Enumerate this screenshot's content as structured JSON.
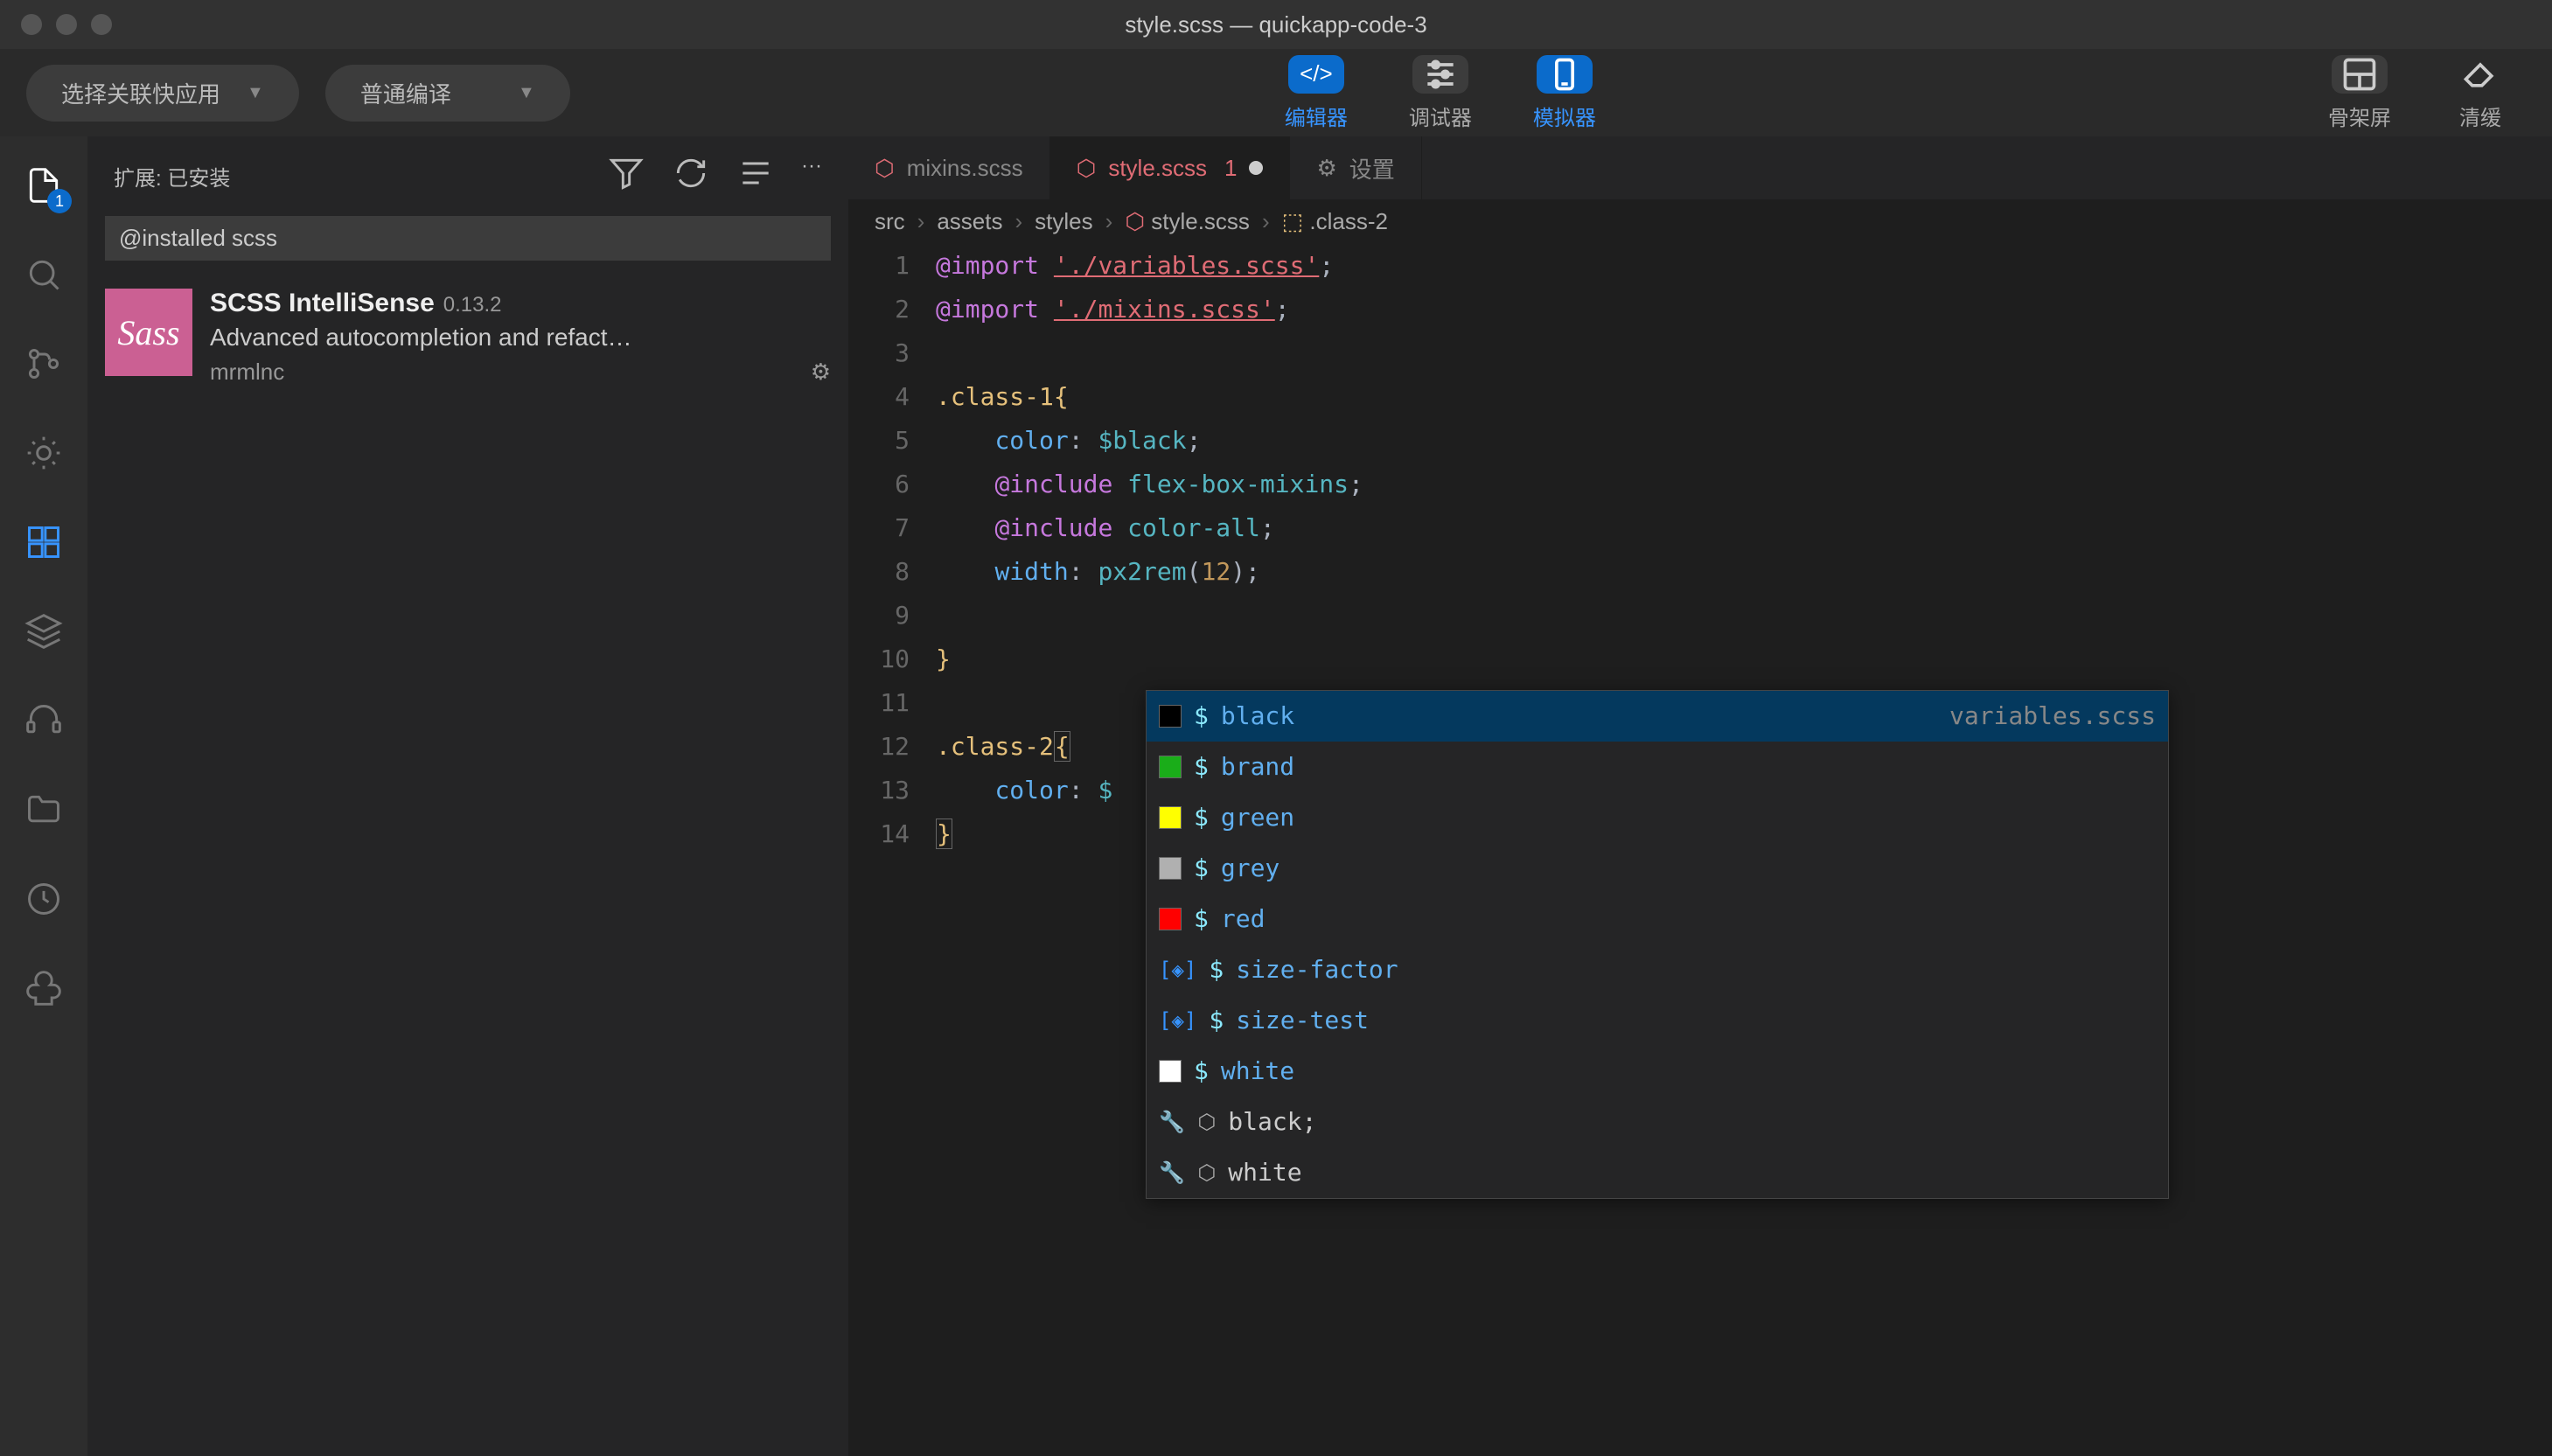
{
  "window": {
    "title": "style.scss — quickapp-code-3"
  },
  "toolbar": {
    "dropdown1": "选择关联快应用",
    "dropdown2": "普通编译",
    "buttons": {
      "editor": "编辑器",
      "debugger": "调试器",
      "simulator": "模拟器",
      "skeleton": "骨架屏",
      "clear": "清缓"
    }
  },
  "sidebar": {
    "header": "扩展: 已安装",
    "search": "@installed scss",
    "ext": {
      "name": "SCSS IntelliSense",
      "version": "0.13.2",
      "desc": "Advanced autocompletion and refact…",
      "author": "mrmlnc",
      "logo": "Sass"
    }
  },
  "tabs": [
    {
      "icon": "sass",
      "label": "mixins.scss",
      "active": false
    },
    {
      "icon": "sass",
      "label": "style.scss",
      "indicator": "1",
      "dirty": true,
      "active": true
    },
    {
      "icon": "settings",
      "label": "设置",
      "active": false
    }
  ],
  "breadcrumbs": [
    "src",
    "assets",
    "styles",
    "style.scss",
    ".class-2"
  ],
  "code": {
    "lines": [
      {
        "n": 1,
        "html": "<span class='kw'>@import</span> <span class='str'>'./variables.scss'</span><span class='punc'>;</span>"
      },
      {
        "n": 2,
        "html": "<span class='kw'>@import</span> <span class='str'>'./mixins.scss'</span><span class='punc'>;</span>"
      },
      {
        "n": 3,
        "html": ""
      },
      {
        "n": 4,
        "html": "<span class='sel'>.class-1</span><span class='brace'>{</span>"
      },
      {
        "n": 5,
        "html": "    <span class='prop'>color</span><span class='punc'>:</span> <span class='var'>$black</span><span class='punc'>;</span>"
      },
      {
        "n": 6,
        "html": "    <span class='inc'>@include</span> <span class='mix'>flex-box-mixins</span><span class='punc'>;</span>"
      },
      {
        "n": 7,
        "html": "    <span class='inc'>@include</span> <span class='mix'>color-all</span><span class='punc'>;</span>"
      },
      {
        "n": 8,
        "html": "    <span class='prop'>width</span><span class='punc'>:</span> <span class='fn'>px2rem</span><span class='punc'>(</span><span class='num'>12</span><span class='punc'>);</span>"
      },
      {
        "n": 9,
        "html": ""
      },
      {
        "n": 10,
        "html": "<span class='brace'>}</span>"
      },
      {
        "n": 11,
        "html": ""
      },
      {
        "n": 12,
        "html": "<span class='sel'>.class-2</span><span class='brace br-hl'>{</span>"
      },
      {
        "n": 13,
        "html": "    <span class='prop'>color</span><span class='punc'>:</span> <span class='var'>$</span>"
      },
      {
        "n": 14,
        "html": "<span class='brace br-hl'>}</span>"
      }
    ]
  },
  "suggestions": {
    "meta": "variables.scss",
    "items": [
      {
        "type": "color",
        "color": "#000000",
        "label": "$black",
        "selected": true
      },
      {
        "type": "color",
        "color": "#1aad19",
        "label": "$brand"
      },
      {
        "type": "color",
        "color": "#ffff00",
        "label": "$green"
      },
      {
        "type": "color",
        "color": "#b0b0b0",
        "label": "$grey"
      },
      {
        "type": "color",
        "color": "#ff0000",
        "label": "$red"
      },
      {
        "type": "var",
        "label": "$size-factor"
      },
      {
        "type": "var",
        "label": "$size-test"
      },
      {
        "type": "color",
        "color": "#ffffff",
        "label": "$white"
      },
      {
        "type": "snippet",
        "label": "black;"
      },
      {
        "type": "snippet",
        "label": "white"
      }
    ]
  },
  "activity_badge": "1"
}
